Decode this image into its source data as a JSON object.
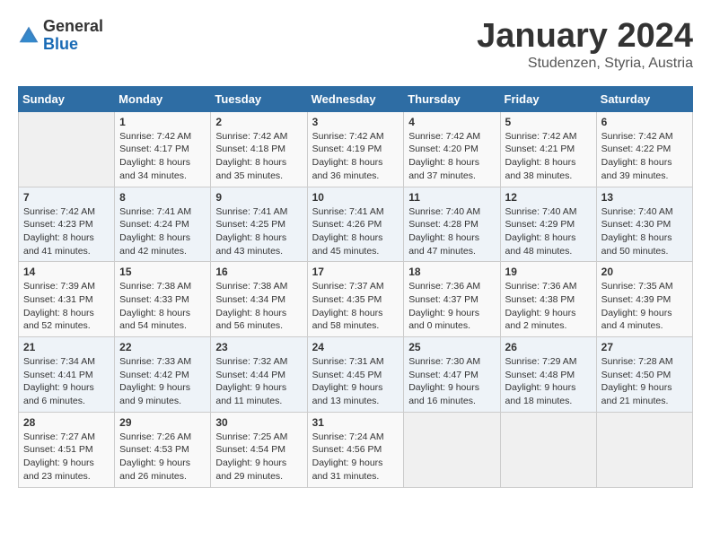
{
  "logo": {
    "general": "General",
    "blue": "Blue"
  },
  "title": "January 2024",
  "subtitle": "Studenzen, Styria, Austria",
  "days_of_week": [
    "Sunday",
    "Monday",
    "Tuesday",
    "Wednesday",
    "Thursday",
    "Friday",
    "Saturday"
  ],
  "weeks": [
    [
      {
        "day": "",
        "sunrise": "",
        "sunset": "",
        "daylight": ""
      },
      {
        "day": "1",
        "sunrise": "Sunrise: 7:42 AM",
        "sunset": "Sunset: 4:17 PM",
        "daylight": "Daylight: 8 hours and 34 minutes."
      },
      {
        "day": "2",
        "sunrise": "Sunrise: 7:42 AM",
        "sunset": "Sunset: 4:18 PM",
        "daylight": "Daylight: 8 hours and 35 minutes."
      },
      {
        "day": "3",
        "sunrise": "Sunrise: 7:42 AM",
        "sunset": "Sunset: 4:19 PM",
        "daylight": "Daylight: 8 hours and 36 minutes."
      },
      {
        "day": "4",
        "sunrise": "Sunrise: 7:42 AM",
        "sunset": "Sunset: 4:20 PM",
        "daylight": "Daylight: 8 hours and 37 minutes."
      },
      {
        "day": "5",
        "sunrise": "Sunrise: 7:42 AM",
        "sunset": "Sunset: 4:21 PM",
        "daylight": "Daylight: 8 hours and 38 minutes."
      },
      {
        "day": "6",
        "sunrise": "Sunrise: 7:42 AM",
        "sunset": "Sunset: 4:22 PM",
        "daylight": "Daylight: 8 hours and 39 minutes."
      }
    ],
    [
      {
        "day": "7",
        "sunrise": "Sunrise: 7:42 AM",
        "sunset": "Sunset: 4:23 PM",
        "daylight": "Daylight: 8 hours and 41 minutes."
      },
      {
        "day": "8",
        "sunrise": "Sunrise: 7:41 AM",
        "sunset": "Sunset: 4:24 PM",
        "daylight": "Daylight: 8 hours and 42 minutes."
      },
      {
        "day": "9",
        "sunrise": "Sunrise: 7:41 AM",
        "sunset": "Sunset: 4:25 PM",
        "daylight": "Daylight: 8 hours and 43 minutes."
      },
      {
        "day": "10",
        "sunrise": "Sunrise: 7:41 AM",
        "sunset": "Sunset: 4:26 PM",
        "daylight": "Daylight: 8 hours and 45 minutes."
      },
      {
        "day": "11",
        "sunrise": "Sunrise: 7:40 AM",
        "sunset": "Sunset: 4:28 PM",
        "daylight": "Daylight: 8 hours and 47 minutes."
      },
      {
        "day": "12",
        "sunrise": "Sunrise: 7:40 AM",
        "sunset": "Sunset: 4:29 PM",
        "daylight": "Daylight: 8 hours and 48 minutes."
      },
      {
        "day": "13",
        "sunrise": "Sunrise: 7:40 AM",
        "sunset": "Sunset: 4:30 PM",
        "daylight": "Daylight: 8 hours and 50 minutes."
      }
    ],
    [
      {
        "day": "14",
        "sunrise": "Sunrise: 7:39 AM",
        "sunset": "Sunset: 4:31 PM",
        "daylight": "Daylight: 8 hours and 52 minutes."
      },
      {
        "day": "15",
        "sunrise": "Sunrise: 7:38 AM",
        "sunset": "Sunset: 4:33 PM",
        "daylight": "Daylight: 8 hours and 54 minutes."
      },
      {
        "day": "16",
        "sunrise": "Sunrise: 7:38 AM",
        "sunset": "Sunset: 4:34 PM",
        "daylight": "Daylight: 8 hours and 56 minutes."
      },
      {
        "day": "17",
        "sunrise": "Sunrise: 7:37 AM",
        "sunset": "Sunset: 4:35 PM",
        "daylight": "Daylight: 8 hours and 58 minutes."
      },
      {
        "day": "18",
        "sunrise": "Sunrise: 7:36 AM",
        "sunset": "Sunset: 4:37 PM",
        "daylight": "Daylight: 9 hours and 0 minutes."
      },
      {
        "day": "19",
        "sunrise": "Sunrise: 7:36 AM",
        "sunset": "Sunset: 4:38 PM",
        "daylight": "Daylight: 9 hours and 2 minutes."
      },
      {
        "day": "20",
        "sunrise": "Sunrise: 7:35 AM",
        "sunset": "Sunset: 4:39 PM",
        "daylight": "Daylight: 9 hours and 4 minutes."
      }
    ],
    [
      {
        "day": "21",
        "sunrise": "Sunrise: 7:34 AM",
        "sunset": "Sunset: 4:41 PM",
        "daylight": "Daylight: 9 hours and 6 minutes."
      },
      {
        "day": "22",
        "sunrise": "Sunrise: 7:33 AM",
        "sunset": "Sunset: 4:42 PM",
        "daylight": "Daylight: 9 hours and 9 minutes."
      },
      {
        "day": "23",
        "sunrise": "Sunrise: 7:32 AM",
        "sunset": "Sunset: 4:44 PM",
        "daylight": "Daylight: 9 hours and 11 minutes."
      },
      {
        "day": "24",
        "sunrise": "Sunrise: 7:31 AM",
        "sunset": "Sunset: 4:45 PM",
        "daylight": "Daylight: 9 hours and 13 minutes."
      },
      {
        "day": "25",
        "sunrise": "Sunrise: 7:30 AM",
        "sunset": "Sunset: 4:47 PM",
        "daylight": "Daylight: 9 hours and 16 minutes."
      },
      {
        "day": "26",
        "sunrise": "Sunrise: 7:29 AM",
        "sunset": "Sunset: 4:48 PM",
        "daylight": "Daylight: 9 hours and 18 minutes."
      },
      {
        "day": "27",
        "sunrise": "Sunrise: 7:28 AM",
        "sunset": "Sunset: 4:50 PM",
        "daylight": "Daylight: 9 hours and 21 minutes."
      }
    ],
    [
      {
        "day": "28",
        "sunrise": "Sunrise: 7:27 AM",
        "sunset": "Sunset: 4:51 PM",
        "daylight": "Daylight: 9 hours and 23 minutes."
      },
      {
        "day": "29",
        "sunrise": "Sunrise: 7:26 AM",
        "sunset": "Sunset: 4:53 PM",
        "daylight": "Daylight: 9 hours and 26 minutes."
      },
      {
        "day": "30",
        "sunrise": "Sunrise: 7:25 AM",
        "sunset": "Sunset: 4:54 PM",
        "daylight": "Daylight: 9 hours and 29 minutes."
      },
      {
        "day": "31",
        "sunrise": "Sunrise: 7:24 AM",
        "sunset": "Sunset: 4:56 PM",
        "daylight": "Daylight: 9 hours and 31 minutes."
      },
      {
        "day": "",
        "sunrise": "",
        "sunset": "",
        "daylight": ""
      },
      {
        "day": "",
        "sunrise": "",
        "sunset": "",
        "daylight": ""
      },
      {
        "day": "",
        "sunrise": "",
        "sunset": "",
        "daylight": ""
      }
    ]
  ]
}
